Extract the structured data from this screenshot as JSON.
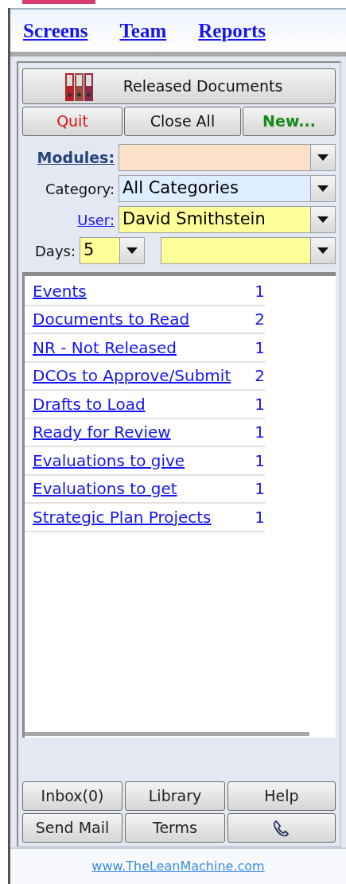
{
  "nav": [
    {
      "label": "Screens"
    },
    {
      "label": "Team"
    },
    {
      "label": "Reports"
    }
  ],
  "title_button": {
    "label": "Released Documents"
  },
  "action_buttons": [
    {
      "label": "Quit",
      "kind": "quit"
    },
    {
      "label": "Close All",
      "kind": "plain"
    },
    {
      "label": "New...",
      "kind": "new"
    }
  ],
  "filters": {
    "modules": {
      "label": "Modules:"
    },
    "category": {
      "label": "Category:",
      "value": "All Categories"
    },
    "user": {
      "label": "User:",
      "value": "David Smithstein"
    },
    "days": {
      "label": "Days:",
      "value": "5"
    }
  },
  "items": [
    {
      "label": "Events",
      "count": "1"
    },
    {
      "label": "Documents to Read",
      "count": "2"
    },
    {
      "label": "NR - Not Released",
      "count": "1"
    },
    {
      "label": "DCOs to Approve/Submit",
      "count": "2"
    },
    {
      "label": "Drafts to Load",
      "count": "1"
    },
    {
      "label": "Ready for Review",
      "count": "1"
    },
    {
      "label": "Evaluations to give",
      "count": "1"
    },
    {
      "label": "Evaluations to get",
      "count": "1"
    },
    {
      "label": "Strategic Plan Projects",
      "count": "1"
    }
  ],
  "bottom_buttons": [
    {
      "kind": "text",
      "label": "Inbox(0)"
    },
    {
      "kind": "text",
      "label": "Library"
    },
    {
      "kind": "text",
      "label": "Help"
    },
    {
      "kind": "text",
      "label": "Send Mail"
    },
    {
      "kind": "text",
      "label": "Terms"
    },
    {
      "kind": "phone"
    }
  ],
  "footer_link": "www.TheLeanMachine.com"
}
